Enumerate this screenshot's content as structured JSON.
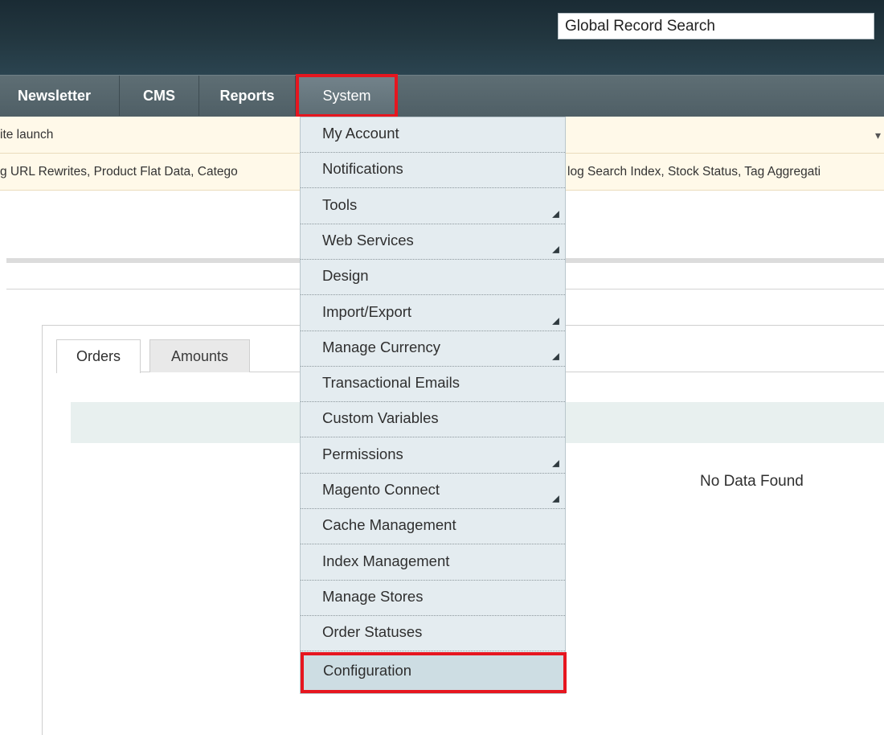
{
  "header": {
    "search_value": "Global Record Search"
  },
  "nav": {
    "items": [
      {
        "label": "Newsletter"
      },
      {
        "label": "CMS"
      },
      {
        "label": "Reports"
      },
      {
        "label": "System"
      }
    ]
  },
  "notices": {
    "line1": "ite launch",
    "line2": "g URL Rewrites, Product Flat Data, Catego",
    "line2_right": "log Search Index, Stock Status, Tag Aggregati"
  },
  "system_menu": {
    "items": [
      {
        "label": "My Account",
        "has_submenu": false
      },
      {
        "label": "Notifications",
        "has_submenu": false
      },
      {
        "label": "Tools",
        "has_submenu": true
      },
      {
        "label": "Web Services",
        "has_submenu": true
      },
      {
        "label": "Design",
        "has_submenu": false
      },
      {
        "label": "Import/Export",
        "has_submenu": true
      },
      {
        "label": "Manage Currency",
        "has_submenu": true
      },
      {
        "label": "Transactional Emails",
        "has_submenu": false
      },
      {
        "label": "Custom Variables",
        "has_submenu": false
      },
      {
        "label": "Permissions",
        "has_submenu": true
      },
      {
        "label": "Magento Connect",
        "has_submenu": true
      },
      {
        "label": "Cache Management",
        "has_submenu": false
      },
      {
        "label": "Index Management",
        "has_submenu": false
      },
      {
        "label": "Manage Stores",
        "has_submenu": false
      },
      {
        "label": "Order Statuses",
        "has_submenu": false
      }
    ],
    "configuration_label": "Configuration"
  },
  "dashboard": {
    "tabs": [
      {
        "label": "Orders"
      },
      {
        "label": "Amounts"
      }
    ],
    "empty_message": "No Data Found"
  },
  "colors": {
    "highlight": "#e6161f",
    "header_bg": "#22363f",
    "nav_bg": "#56666d",
    "menu_bg": "#e4ecf0",
    "notice_bg": "#fff9e9"
  }
}
